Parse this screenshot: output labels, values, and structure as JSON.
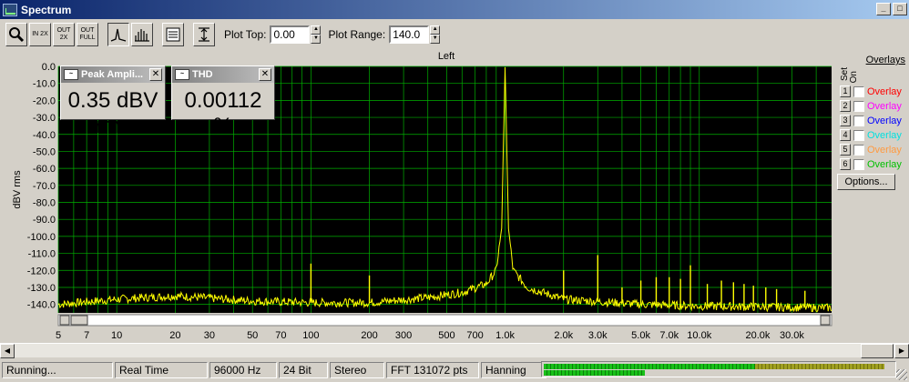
{
  "window": {
    "title": "Spectrum"
  },
  "toolbar": {
    "buttons": [
      {
        "name": "zoom-button",
        "icon": "magnifier-icon",
        "label": ""
      },
      {
        "name": "zoom-in-2x-button",
        "icon": "zoom-in-icon",
        "label": "IN 2X"
      },
      {
        "name": "zoom-out-2x-button",
        "icon": "zoom-out-icon",
        "label": "OUT 2X"
      },
      {
        "name": "zoom-out-full-button",
        "icon": "zoom-full-icon",
        "label": "OUT FULL"
      },
      {
        "name": "line-mode-button",
        "icon": "line-spectrum-icon",
        "label": ""
      },
      {
        "name": "bar-mode-button",
        "icon": "bar-spectrum-icon",
        "label": ""
      },
      {
        "name": "settings-button",
        "icon": "settings-icon",
        "label": ""
      },
      {
        "name": "autoscale-button",
        "icon": "vertical-range-icon",
        "label": ""
      }
    ],
    "plot_top_label": "Plot Top:",
    "plot_top_value": "0.00",
    "plot_range_label": "Plot Range:",
    "plot_range_value": "140.0"
  },
  "meters": [
    {
      "title": "Peak Ampli...",
      "value": "0.35 dBV rms"
    },
    {
      "title": "THD",
      "value": "0.00112 %"
    }
  ],
  "overlays": {
    "title": "Overlays",
    "set_label": "Set",
    "on_label": "On",
    "items": [
      {
        "num": "1",
        "label": "Overlay",
        "color": "#ff0000"
      },
      {
        "num": "2",
        "label": "Overlay",
        "color": "#ff00ff"
      },
      {
        "num": "3",
        "label": "Overlay",
        "color": "#0000ff"
      },
      {
        "num": "4",
        "label": "Overlay",
        "color": "#00e0e0"
      },
      {
        "num": "5",
        "label": "Overlay",
        "color": "#ff9a40"
      },
      {
        "num": "6",
        "label": "Overlay",
        "color": "#00c000"
      }
    ],
    "options_label": "Options..."
  },
  "status": {
    "state": "Running...",
    "mode": "Real Time",
    "rate": "96000 Hz",
    "bits": "24 Bit",
    "channels": "Stereo",
    "fft": "FFT 131072 pts",
    "window": "Hanning",
    "level_left": 0.24,
    "level_right": 0.29
  },
  "chart_data": {
    "type": "line",
    "title": "Left",
    "ylabel": "dBV rms",
    "xlabel": "",
    "xscale": "log",
    "xlim": [
      5,
      48000
    ],
    "ylim": [
      -145,
      0
    ],
    "grid": true,
    "background": "#000000",
    "grid_color": "#00b000",
    "line_color": "#ffff00",
    "x_ticks": [
      "5",
      "7",
      "10",
      "20",
      "30",
      "50",
      "70",
      "100",
      "200",
      "300",
      "500",
      "700",
      "1.0k",
      "2.0k",
      "3.0k",
      "5.0k",
      "7.0k",
      "10.0k",
      "20.0k",
      "30.0k"
    ],
    "y_ticks": [
      "0.0",
      "-10.0",
      "-20.0",
      "-30.0",
      "-40.0",
      "-50.0",
      "-60.0",
      "-70.0",
      "-80.0",
      "-90.0",
      "-100.0",
      "-110.0",
      "-120.0",
      "-130.0",
      "-140.0"
    ],
    "peaks": [
      {
        "x": 100,
        "y": -116
      },
      {
        "x": 200,
        "y": -123
      },
      {
        "x": 1000,
        "y": 0.35
      },
      {
        "x": 2000,
        "y": -120
      },
      {
        "x": 3000,
        "y": -111
      },
      {
        "x": 4000,
        "y": -130
      },
      {
        "x": 5000,
        "y": -126
      },
      {
        "x": 6000,
        "y": -124
      },
      {
        "x": 7000,
        "y": -124
      },
      {
        "x": 8000,
        "y": -125
      },
      {
        "x": 9000,
        "y": -117
      },
      {
        "x": 11000,
        "y": -128
      },
      {
        "x": 13000,
        "y": -126
      },
      {
        "x": 15000,
        "y": -127
      },
      {
        "x": 17000,
        "y": -128
      },
      {
        "x": 19000,
        "y": -129
      },
      {
        "x": 22000,
        "y": -130
      },
      {
        "x": 25000,
        "y": -131
      },
      {
        "x": 35000,
        "y": -132
      }
    ],
    "noise_floor": [
      {
        "x": 5,
        "y": -140
      },
      {
        "x": 10,
        "y": -137
      },
      {
        "x": 20,
        "y": -135
      },
      {
        "x": 50,
        "y": -138
      },
      {
        "x": 100,
        "y": -139
      },
      {
        "x": 200,
        "y": -139
      },
      {
        "x": 400,
        "y": -136
      },
      {
        "x": 600,
        "y": -133
      },
      {
        "x": 800,
        "y": -128
      },
      {
        "x": 900,
        "y": -120
      },
      {
        "x": 960,
        "y": -95
      },
      {
        "x": 1000,
        "y": 0.35
      },
      {
        "x": 1040,
        "y": -95
      },
      {
        "x": 1100,
        "y": -120
      },
      {
        "x": 1300,
        "y": -130
      },
      {
        "x": 2000,
        "y": -137
      },
      {
        "x": 5000,
        "y": -140
      },
      {
        "x": 10000,
        "y": -141
      },
      {
        "x": 48000,
        "y": -142
      }
    ]
  }
}
